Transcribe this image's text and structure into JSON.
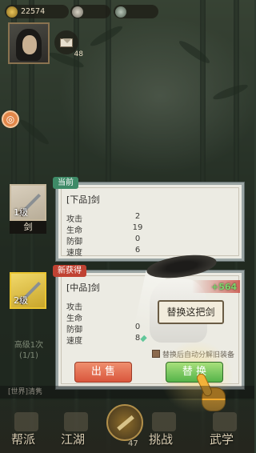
{
  "hud": {
    "resource_1": "22574",
    "mail_label": "48",
    "side_bubble": "◎"
  },
  "current": {
    "tag": "当前",
    "title": "[下品]剑",
    "slot_level": "1级",
    "slot_name": "剑",
    "stats": [
      {
        "label": "攻击",
        "value": "2"
      },
      {
        "label": "生命",
        "value": "19"
      },
      {
        "label": "防御",
        "value": "0"
      },
      {
        "label": "速度",
        "value": "6"
      }
    ]
  },
  "new": {
    "tag": "新获得",
    "title": "[中品]剑",
    "slot_level": "2级",
    "stats": [
      {
        "label": "攻击",
        "value": ""
      },
      {
        "label": "生命",
        "value": ""
      },
      {
        "label": "防御",
        "value": "0"
      },
      {
        "label": "速度",
        "value": "8"
      }
    ],
    "bonus": "+564",
    "replace_popup": "替换这把剑",
    "auto_check_label": "替换后自动分解旧装备",
    "sell_button": "出 售",
    "swap_button": "替 换"
  },
  "under_slots": {
    "line1": "高级1次",
    "line2": "(1/1)"
  },
  "chat": "[世界]清隽",
  "nav": {
    "items": [
      "帮派",
      "江湖",
      "挑战",
      "武学"
    ],
    "center_count": "47"
  }
}
